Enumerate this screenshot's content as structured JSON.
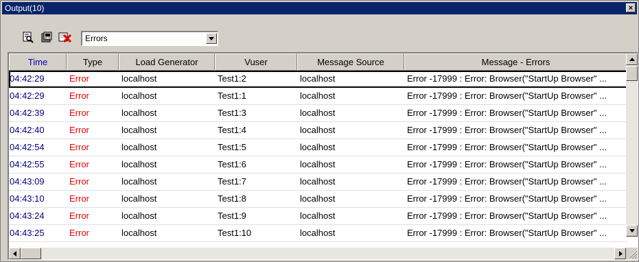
{
  "window": {
    "title": "Output(10)",
    "close_glyph": "×"
  },
  "toolbar": {
    "icons": [
      "view-details-icon",
      "export-icon",
      "clear-errors-icon"
    ],
    "filter_value": "Errors"
  },
  "table": {
    "columns": [
      "Time",
      "Type",
      "Load Generator",
      "Vuser",
      "Message Source",
      "Message - Errors"
    ],
    "rows": [
      {
        "time": "04:42:29",
        "type": "Error",
        "generator": "localhost",
        "vuser": "Test1:2",
        "source": "localhost",
        "message": "Error -17999 : Error: Browser(\"StartUp Browser\" ..."
      },
      {
        "time": "04:42:29",
        "type": "Error",
        "generator": "localhost",
        "vuser": "Test1:1",
        "source": "localhost",
        "message": "Error -17999 : Error: Browser(\"StartUp Browser\" ..."
      },
      {
        "time": "04:42:39",
        "type": "Error",
        "generator": "localhost",
        "vuser": "Test1:3",
        "source": "localhost",
        "message": "Error -17999 : Error: Browser(\"StartUp Browser\" ..."
      },
      {
        "time": "04:42:40",
        "type": "Error",
        "generator": "localhost",
        "vuser": "Test1:4",
        "source": "localhost",
        "message": "Error -17999 : Error: Browser(\"StartUp Browser\" ..."
      },
      {
        "time": "04:42:54",
        "type": "Error",
        "generator": "localhost",
        "vuser": "Test1:5",
        "source": "localhost",
        "message": "Error -17999 : Error: Browser(\"StartUp Browser\" ..."
      },
      {
        "time": "04:42:55",
        "type": "Error",
        "generator": "localhost",
        "vuser": "Test1:6",
        "source": "localhost",
        "message": "Error -17999 : Error: Browser(\"StartUp Browser\" ..."
      },
      {
        "time": "04:43:09",
        "type": "Error",
        "generator": "localhost",
        "vuser": "Test1:7",
        "source": "localhost",
        "message": "Error -17999 : Error: Browser(\"StartUp Browser\" ..."
      },
      {
        "time": "04:43:10",
        "type": "Error",
        "generator": "localhost",
        "vuser": "Test1:8",
        "source": "localhost",
        "message": "Error -17999 : Error: Browser(\"StartUp Browser\" ..."
      },
      {
        "time": "04:43:24",
        "type": "Error",
        "generator": "localhost",
        "vuser": "Test1:9",
        "source": "localhost",
        "message": "Error -17999 : Error: Browser(\"StartUp Browser\" ..."
      },
      {
        "time": "04:43:25",
        "type": "Error",
        "generator": "localhost",
        "vuser": "Test1:10",
        "source": "localhost",
        "message": "Error -17999 : Error: Browser(\"StartUp Browser\" ..."
      }
    ]
  },
  "colors": {
    "titlebar": "#0a246a",
    "time_header": "#0000c0",
    "error_text": "#e00000"
  }
}
